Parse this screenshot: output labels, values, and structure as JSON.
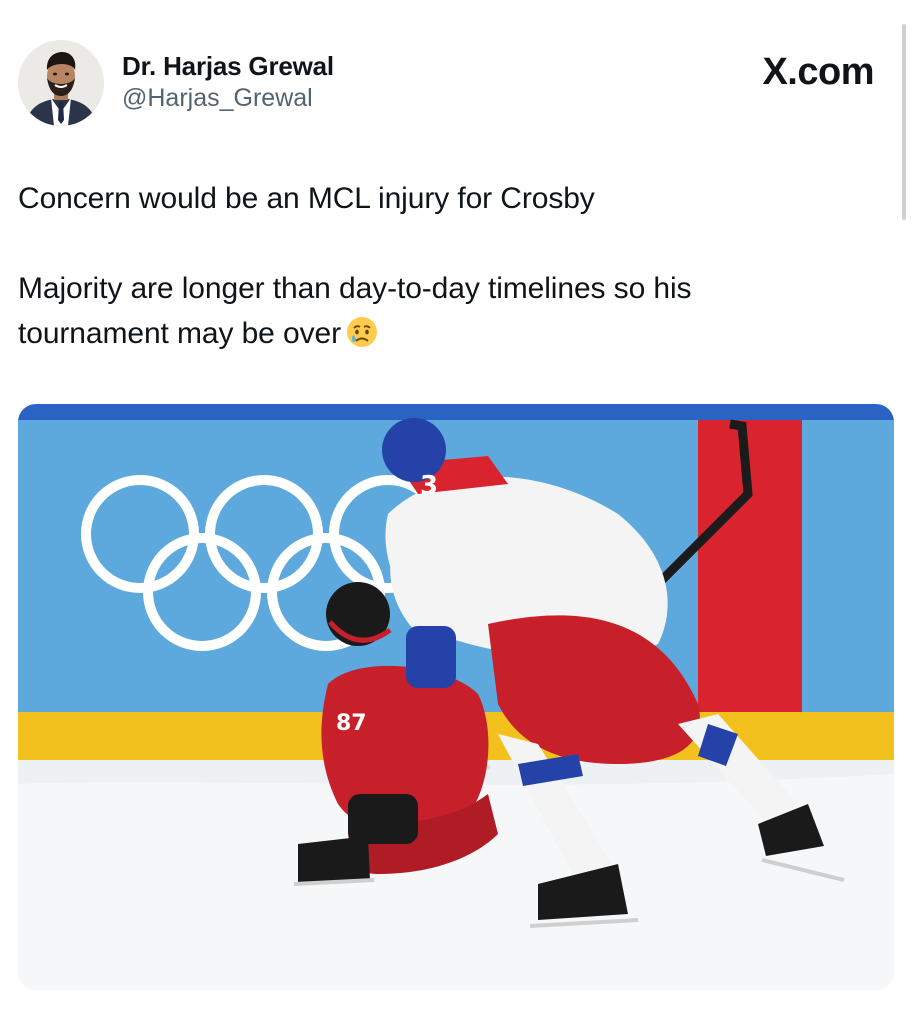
{
  "author": {
    "display_name": "Dr. Harjas Grewal",
    "handle": "@Harjas_Grewal",
    "avatar_icon": "profile-photo"
  },
  "site": {
    "label": "X.com"
  },
  "tweet": {
    "line1": "Concern would be an MCL injury for Crosby",
    "line2": "Majority are longer than day-to-day timelines so his",
    "line3": "tournament may be over",
    "emoji_icon": "crying-face-emoji"
  },
  "media": {
    "description_icon": "hockey-photo",
    "jersey_numbers": [
      "87",
      "3"
    ]
  },
  "colors": {
    "text": "#0f1419",
    "secondary_text": "#536471",
    "background": "#ffffff"
  }
}
